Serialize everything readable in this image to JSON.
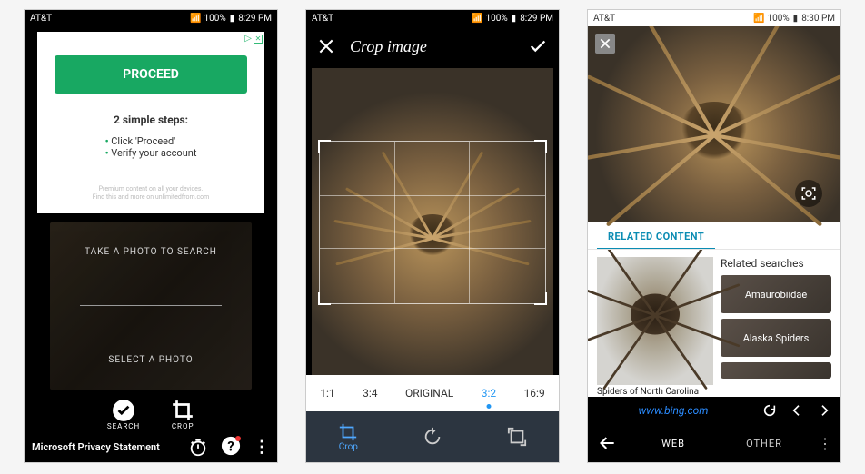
{
  "status": {
    "carrier": "AT&T",
    "battery": "100%",
    "time1": "8:29 PM",
    "time2": "8:29 PM",
    "time3": "8:30 PM",
    "signal_glyphs": "⋮ ▾ ▴ ◢"
  },
  "screen1": {
    "ad": {
      "proceed": "PROCEED",
      "steps_title": "2 simple steps:",
      "step1": "Click 'Proceed'",
      "step2": "Verify your account",
      "fine1": "Premium content on all your devices.",
      "fine2": "Find this and more on unlimitedfrom.com"
    },
    "take_photo": "TAKE A PHOTO TO SEARCH",
    "select_photo": "SELECT A PHOTO",
    "search_label": "SEARCH",
    "crop_label": "CROP",
    "privacy": "Microsoft Privacy Statement"
  },
  "screen2": {
    "title": "Crop image",
    "ratios": {
      "r1": "1:1",
      "r2": "3:4",
      "r3": "ORIGINAL",
      "r4": "3:2",
      "r5": "16:9"
    },
    "selected_ratio": "3:2",
    "crop_label": "Crop"
  },
  "screen3": {
    "related_header": "RELATED CONTENT",
    "main_caption": "Spiders of North Carolina",
    "related_title": "Related searches",
    "chip1": "Amaurobiidae",
    "chip2": "Alaska Spiders",
    "url": "www.bing.com",
    "tab_web": "WEB",
    "tab_other": "OTHER"
  }
}
